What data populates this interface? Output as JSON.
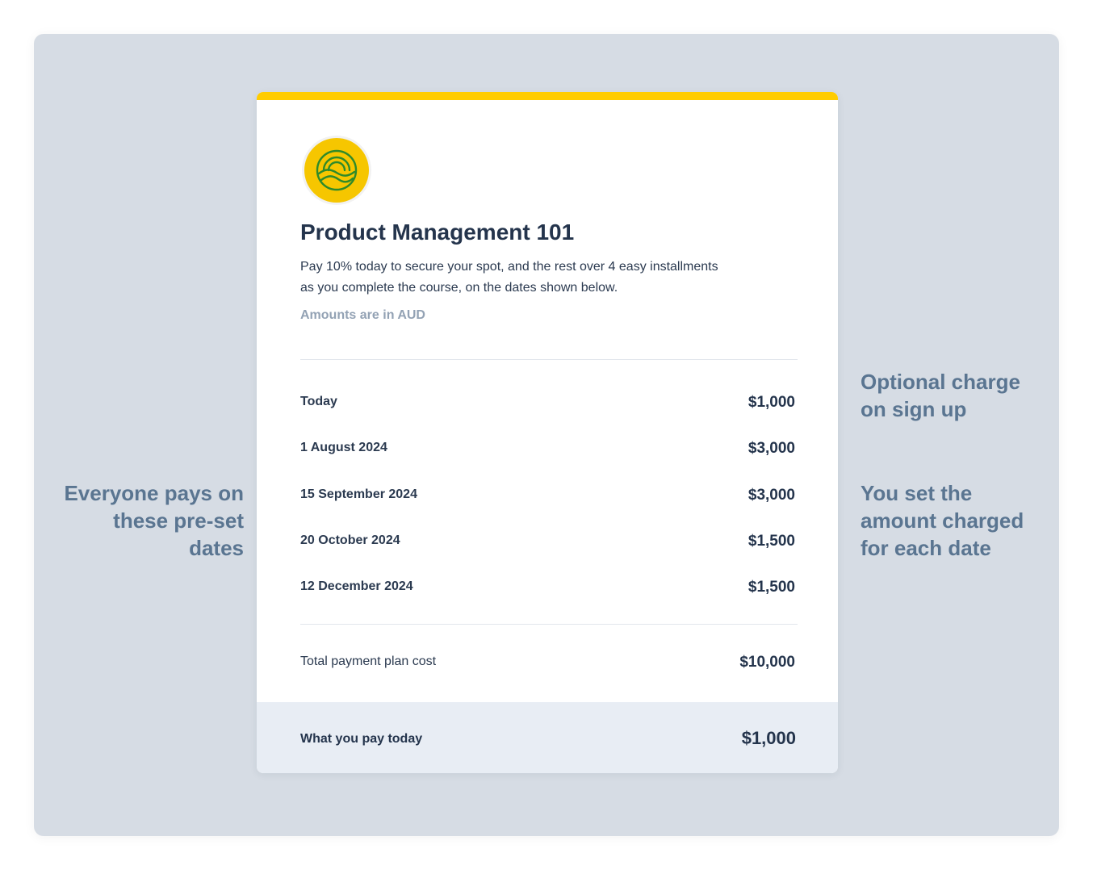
{
  "card": {
    "title": "Product Management 101",
    "description_line1": "Pay 10% today to secure your spot, and the rest over 4 easy installments",
    "description_line2": "as you complete the course, on the dates shown below.",
    "currency_note": "Amounts are in AUD"
  },
  "schedule": [
    {
      "label": "Today",
      "amount": "$1,000"
    },
    {
      "label": "1 August 2024",
      "amount": "$3,000"
    },
    {
      "label": "15 September 2024",
      "amount": "$3,000"
    },
    {
      "label": "20 October 2024",
      "amount": "$1,500"
    },
    {
      "label": "12 December 2024",
      "amount": "$1,500"
    }
  ],
  "total": {
    "label": "Total payment plan cost",
    "amount": "$10,000"
  },
  "footer": {
    "label": "What you pay today",
    "amount": "$1,000"
  },
  "annotations": {
    "left": [
      "Everyone pays on",
      "these pre-set",
      "dates"
    ],
    "right_top": [
      "Optional charge",
      "on sign up"
    ],
    "right_bottom": [
      "You set the",
      "amount charged",
      "for each date"
    ]
  },
  "colors": {
    "accent": "#ffcc00",
    "logo_fill": "#f6c600",
    "logo_stroke": "#2e8a2a",
    "annotation": "#5a7591",
    "footer_bg": "#e8edf4"
  },
  "icons": {
    "logo": "sun-over-hills-icon"
  }
}
